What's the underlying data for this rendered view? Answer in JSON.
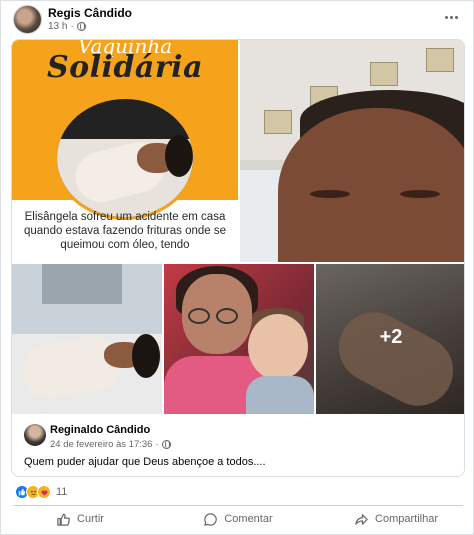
{
  "post": {
    "author": "Regis Cândido",
    "time": "13 h",
    "time_separator": "·",
    "icons": {
      "privacy": "globe-icon",
      "menu": "more-options-icon"
    }
  },
  "shared_post": {
    "flyer": {
      "title_top": "Vaquinha",
      "title_main": "Solidária",
      "caption": "Elisângela sofreu um acidente em casa quando estava fazendo frituras onde se queimou com óleo, tendo"
    },
    "extra_photos": "+2",
    "author": "Reginaldo Cândido",
    "date": "24 de fevereiro às 17:36",
    "date_separator": "·",
    "text": "Quem puder ajudar que Deus abençoe a todos...."
  },
  "reactions": {
    "types": [
      "like",
      "sad",
      "care"
    ],
    "count": "11"
  },
  "actions": {
    "like": "Curtir",
    "comment": "Comentar",
    "share": "Compartilhar"
  },
  "colors": {
    "flyer_orange": "#f6a31c",
    "facebook_blue": "#1877f2",
    "secondary_text": "#65676b"
  }
}
